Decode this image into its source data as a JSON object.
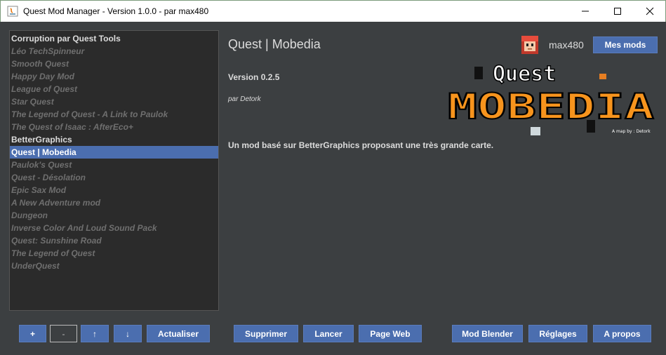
{
  "window": {
    "title": "Quest Mod Manager - Version 1.0.0 - par max480"
  },
  "mod_list": [
    {
      "label": "Corruption par Quest Tools",
      "state": "enabled"
    },
    {
      "label": "Léo TechSpinneur",
      "state": "disabled"
    },
    {
      "label": "Smooth Quest",
      "state": "disabled"
    },
    {
      "label": "Happy Day Mod",
      "state": "disabled"
    },
    {
      "label": "League of Quest",
      "state": "disabled"
    },
    {
      "label": "Star Quest",
      "state": "disabled"
    },
    {
      "label": "The Legend of Quest - A Link to Paulok",
      "state": "disabled"
    },
    {
      "label": "The Quest of Isaac : AfterEco+",
      "state": "disabled"
    },
    {
      "label": "BetterGraphics",
      "state": "enabled"
    },
    {
      "label": "Quest | Mobedia",
      "state": "selected"
    },
    {
      "label": "Paulok's Quest",
      "state": "disabled"
    },
    {
      "label": "Quest - Désolation",
      "state": "disabled"
    },
    {
      "label": "Epic Sax Mod",
      "state": "disabled"
    },
    {
      "label": "A New Adventure mod",
      "state": "disabled"
    },
    {
      "label": "Dungeon",
      "state": "disabled"
    },
    {
      "label": "Inverse Color And Loud Sound Pack",
      "state": "disabled"
    },
    {
      "label": "Quest: Sunshine Road",
      "state": "disabled"
    },
    {
      "label": "The Legend of Quest",
      "state": "disabled"
    },
    {
      "label": "UnderQuest",
      "state": "disabled"
    }
  ],
  "detail": {
    "title": "Quest | Mobedia",
    "version": "Version 0.2.5",
    "author": "par Detork",
    "description": "Un mod basé sur BetterGraphics proposant une très grande carte.",
    "logo_line1": "Quest",
    "logo_line2": "MOBEDIA",
    "logo_caption": "A map by : Detork"
  },
  "user": {
    "name": "max480",
    "my_mods_label": "Mes mods"
  },
  "toolbar": {
    "add": "+",
    "remove": "-",
    "up": "↑",
    "down": "↓",
    "refresh": "Actualiser",
    "delete": "Supprimer",
    "launch": "Lancer",
    "webpage": "Page Web",
    "mod_blender": "Mod Blender",
    "settings": "Réglages",
    "about": "A propos"
  },
  "colors": {
    "background": "#3c3f41",
    "list_background": "#2b2b2b",
    "accent": "#4b6eaf",
    "logo_orange": "#f7941d"
  }
}
